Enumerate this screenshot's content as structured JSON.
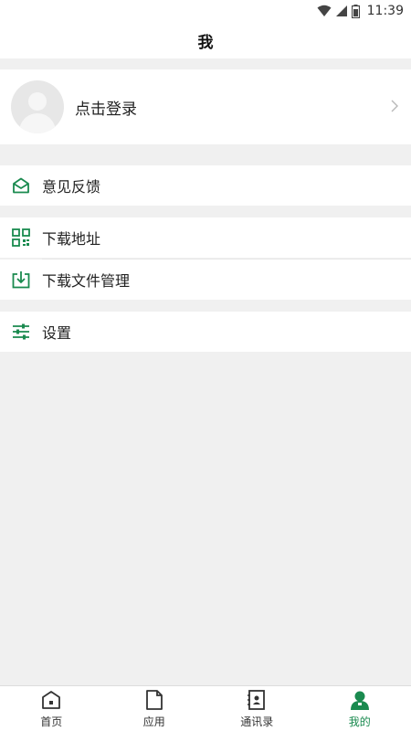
{
  "status_bar": {
    "time": "11:39"
  },
  "header": {
    "title": "我"
  },
  "profile": {
    "login_label": "点击登录"
  },
  "menu": {
    "feedback": "意见反馈",
    "download_address": "下载地址",
    "download_files": "下载文件管理",
    "settings": "设置"
  },
  "tabs": [
    {
      "label": "首页",
      "icon": "home-icon"
    },
    {
      "label": "应用",
      "icon": "document-icon"
    },
    {
      "label": "通讯录",
      "icon": "contacts-icon"
    },
    {
      "label": "我的",
      "icon": "person-icon",
      "active": true
    }
  ],
  "colors": {
    "accent": "#1a8a4f",
    "background": "#f0f0f0"
  }
}
